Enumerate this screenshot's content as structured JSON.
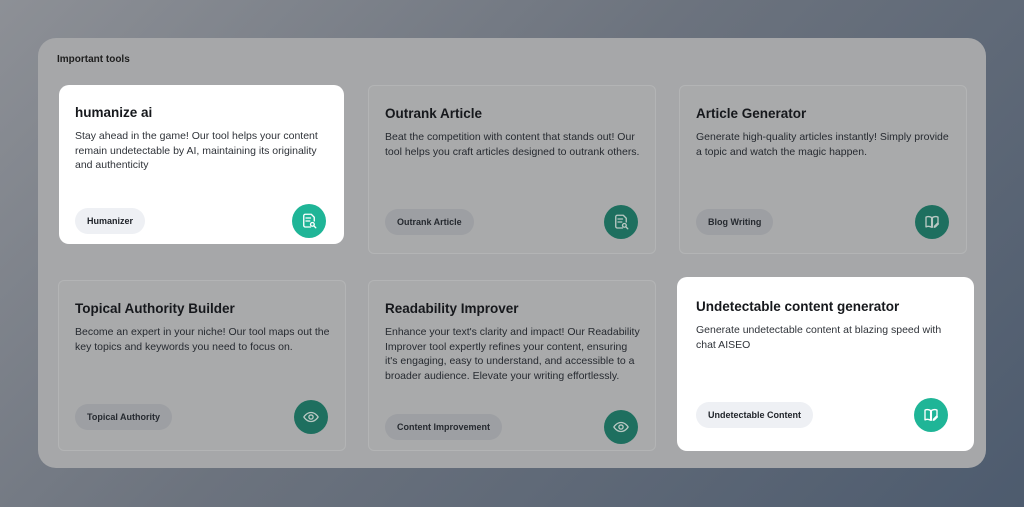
{
  "panel": {
    "title": "Important tools"
  },
  "cards": [
    {
      "title": "humanize ai",
      "description": "Stay ahead in the game! Our tool helps your content remain undetectable by AI, maintaining its originality and authenticity",
      "tag": "Humanizer",
      "icon": "document-search-icon"
    },
    {
      "title": "Outrank Article",
      "description": "Beat the competition with content that stands out! Our tool helps you craft articles designed to outrank others.",
      "tag": "Outrank Article",
      "icon": "document-search-icon"
    },
    {
      "title": "Article Generator",
      "description": "Generate high-quality articles instantly! Simply provide a topic and watch the magic happen.",
      "tag": "Blog Writing",
      "icon": "book-pen-icon"
    },
    {
      "title": "Topical Authority Builder",
      "description": "Become an expert in your niche! Our tool maps out the key topics and keywords you need to focus on.",
      "tag": "Topical Authority",
      "icon": "eye-icon"
    },
    {
      "title": "Readability Improver",
      "description": "Enhance your text's clarity and impact! Our Readability Improver tool expertly refines your content, ensuring it's engaging, easy to understand, and accessible to a broader audience. Elevate your writing effortlessly.",
      "tag": "Content Improvement",
      "icon": "eye-icon"
    },
    {
      "title": "Undetectable content generator",
      "description": "Generate undetectable content at blazing speed with chat AISEO",
      "tag": "Undetectable Content",
      "icon": "book-pen-icon"
    }
  ]
}
